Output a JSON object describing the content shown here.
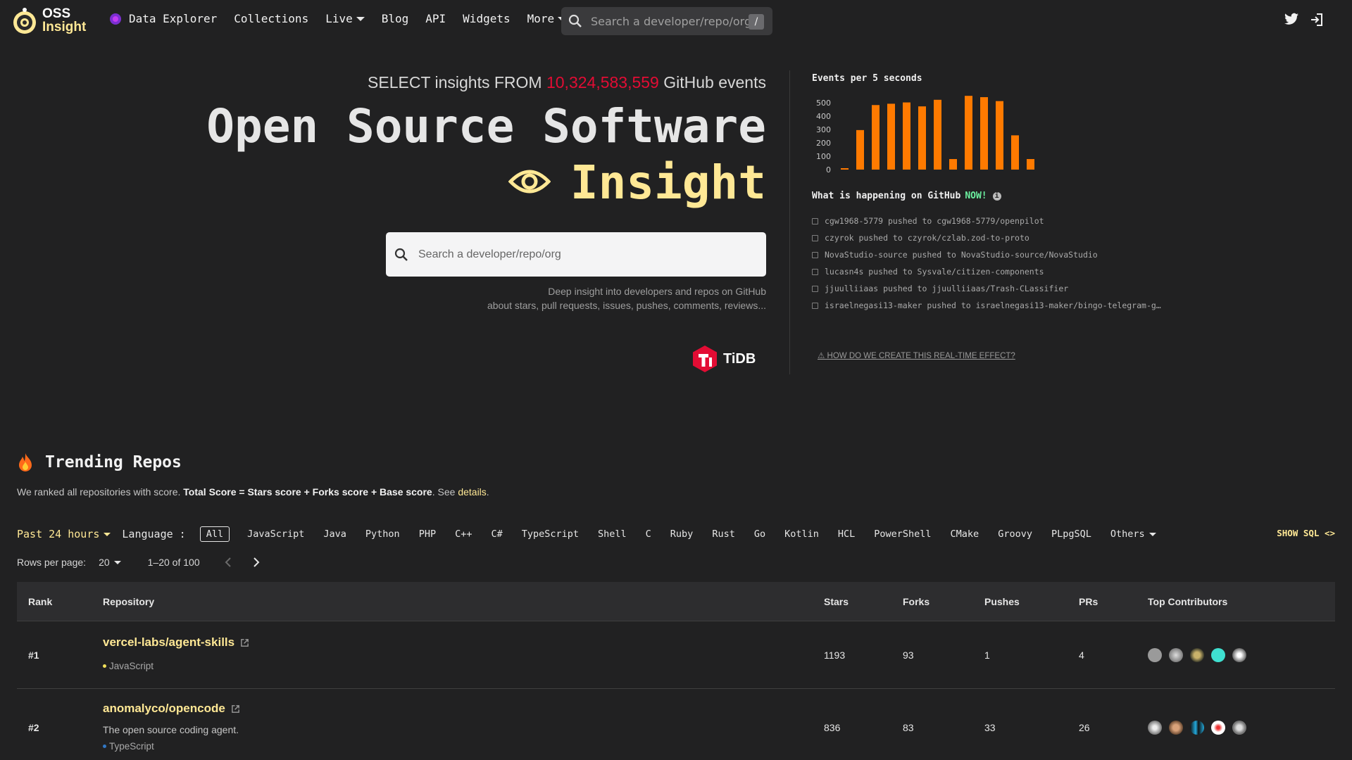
{
  "nav": {
    "logo_line1": "OSS",
    "logo_line2": "Insight",
    "links": [
      "Data Explorer",
      "Collections",
      "Live",
      "Blog",
      "API",
      "Widgets",
      "More"
    ],
    "search_placeholder": "Search a developer/repo/org",
    "search_shortcut": "/"
  },
  "hero": {
    "tagline_pre": "SELECT insights FROM",
    "tagline_count": "10,324,583,559",
    "tagline_post": "GitHub events",
    "title_line1": "Open Source Software",
    "title_line2": "Insight",
    "search_placeholder": "Search a developer/repo/org",
    "desc_line1": "Deep insight into developers and repos on GitHub",
    "desc_line2": "about stars, pull requests, issues, pushes, comments, reviews...",
    "powered_by": "TiDB"
  },
  "live": {
    "events_title": "Events per 5 seconds",
    "happening_title": "What is happening on GitHub",
    "happening_now": "NOW!",
    "events": [
      "cgw1968-5779 pushed to cgw1968-5779/openpilot",
      "czyrok pushed to czyrok/czlab.zod-to-proto",
      "NovaStudio-source pushed to NovaStudio-source/NovaStudio",
      "lucasn4s pushed to Sysvale/citizen-components",
      "jjuulliiaas pushed to jjuulliiaas/Trash-CLassifier",
      "israelnegasi13-maker pushed to israelnegasi13-maker/bingo-telegram-g…"
    ],
    "realtime_link": "HOW DO WE CREATE THIS REAL-TIME EFFECT?"
  },
  "chart_data": {
    "type": "bar",
    "title": "Events per 5 seconds",
    "yticks": [
      "0",
      "100",
      "200",
      "300",
      "400",
      "500"
    ],
    "ylim": [
      0,
      500
    ],
    "values": [
      10,
      300,
      490,
      500,
      510,
      480,
      530,
      80,
      560,
      550,
      520,
      260,
      80
    ],
    "color": "#ff7a00",
    "grid": false
  },
  "trending": {
    "title": "Trending Repos",
    "desc_pre": "We ranked all repositories with score.",
    "desc_bold": "Total Score = Stars score + Forks score + Base score",
    "desc_see": ". See",
    "desc_link": "details",
    "desc_end": ".",
    "period": "Past 24 hours",
    "language_label": "Language :",
    "languages": [
      "All",
      "JavaScript",
      "Java",
      "Python",
      "PHP",
      "C++",
      "C#",
      "TypeScript",
      "Shell",
      "C",
      "Ruby",
      "Rust",
      "Go",
      "Kotlin",
      "HCL",
      "PowerShell",
      "CMake",
      "Groovy",
      "PLpgSQL",
      "Others"
    ],
    "show_sql": "SHOW SQL",
    "rows_per_page_label": "Rows per page:",
    "rows_per_page": "20",
    "range": "1–20 of 100",
    "columns": [
      "Rank",
      "Repository",
      "Stars",
      "Forks",
      "Pushes",
      "PRs",
      "Top Contributors"
    ],
    "rows": [
      {
        "rank": "#1",
        "repo": "vercel-labs/agent-skills",
        "desc": "",
        "lang": "JavaScript",
        "lang_color": "#f1e05a",
        "stars": "1193",
        "forks": "93",
        "pushes": "1",
        "prs": "4"
      },
      {
        "rank": "#2",
        "repo": "anomalyco/opencode",
        "desc": "The open source coding agent.",
        "lang": "TypeScript",
        "lang_color": "#3178c6",
        "stars": "836",
        "forks": "83",
        "pushes": "33",
        "prs": "26"
      }
    ]
  }
}
